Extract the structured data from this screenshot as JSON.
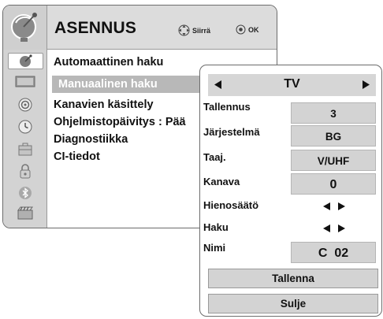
{
  "header": {
    "title": "ASENNUS",
    "icon": "satellite-dish-icon",
    "hints": [
      {
        "icon": "move-arrows-icon",
        "label": "Siirrä"
      },
      {
        "icon": "ok-circle-icon",
        "label": "OK"
      }
    ]
  },
  "rail_icons": [
    "setup-dish-icon",
    "picture-icon",
    "audio-speaker-icon",
    "clock-icon",
    "options-suitcase-icon",
    "lock-icon",
    "bluetooth-icon",
    "usb-film-icon"
  ],
  "menu": {
    "items": [
      "Automaattinen haku",
      "Manuaalinen haku",
      "Kanavien käsittely",
      "Ohjelmistopäivitys : Pää",
      "Diagnostiikka",
      "CI-tiedot"
    ],
    "selected_index": 1
  },
  "sub": {
    "source": "TV",
    "fields": [
      {
        "label": "Tallennus",
        "value": "3"
      },
      {
        "label": "Järjestelmä",
        "value": "BG"
      },
      {
        "label": "Taaj.",
        "value": "V/UHF"
      },
      {
        "label": "Kanava",
        "value": "0"
      },
      {
        "label": "Hienosäätö",
        "value": ""
      },
      {
        "label": "Haku",
        "value": ""
      },
      {
        "label": "Nimi",
        "value": "C  02"
      }
    ],
    "store_button": "Tallenna",
    "close_button": "Sulje"
  },
  "colors": {
    "panel_bg": "#dcdcdc",
    "highlight": "#b8b8b8",
    "field_bg": "#d3d3d3",
    "text": "#111111"
  }
}
